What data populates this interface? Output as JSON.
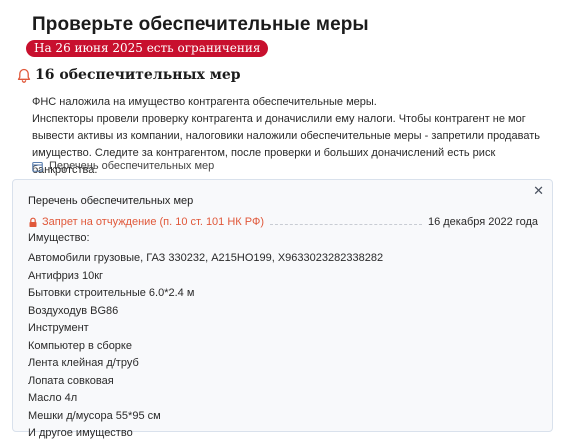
{
  "header": {
    "title": "Проверьте обеспечительные меры",
    "badge": "На 26 июня 2025 есть ограничения"
  },
  "section": {
    "title": "16 обеспечительных мер",
    "icon": "bell-icon",
    "description_lines": [
      "ФНС наложила на имущество контрагента обеспечительные меры.",
      "Инспекторы провели проверку контрагента и доначислили ему налоги. Чтобы контрагент не мог вывести активы из компании, налоговики наложили обеспечительные меры - запретили продавать имущество. Следите за контрагентом, после проверки и больших доначислений есть риск банкротства."
    ],
    "list_link": "Перечень обеспечительных мер"
  },
  "panel": {
    "title": "Перечень обеспечительных мер",
    "restriction": {
      "type": "Запрет на отчуждение (п. 10 ст. 101 НК РФ)",
      "date": "16 декабря 2022 года"
    },
    "property_label": "Имущество:",
    "property_items": [
      "Автомобили грузовые, ГАЗ 330232, А215НО199, Х9633023282338282",
      "Антифриз 10кг",
      "Бытовки строительные 6.0*2.4 м",
      "Воздуходув BG86",
      "Инструмент",
      "Компьютер в сборке",
      "Лента клейная д/труб",
      "Лопата совковая",
      "Масло 4л",
      "Мешки д/мусора 55*95 см",
      "И другое имущество"
    ]
  },
  "colors": {
    "badge_bg": "#c8102e",
    "accent_orange": "#e0583a",
    "panel_border": "#d9e1ec"
  }
}
